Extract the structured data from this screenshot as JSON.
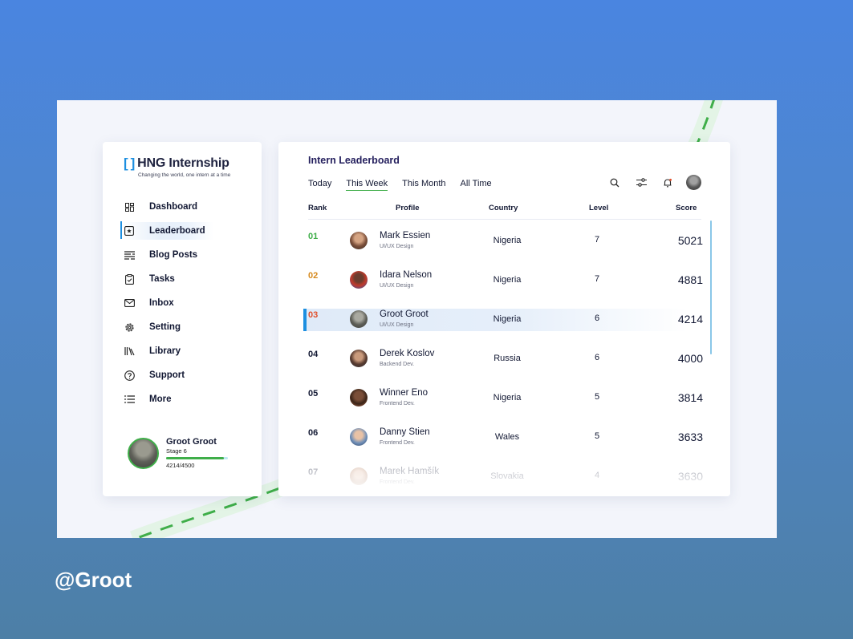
{
  "brand": {
    "title": "HNG Internship",
    "subtitle": "Changing the world, one intern at a time"
  },
  "colors": {
    "accent": "#1d8fe0",
    "success": "#3fae49",
    "rank1": "#3fae49",
    "rank2": "#d68a1e",
    "rank3": "#e1502c",
    "title": "#25205e"
  },
  "sidebar": {
    "items": [
      {
        "label": "Dashboard",
        "icon": "dashboard-icon"
      },
      {
        "label": "Leaderboard",
        "icon": "leaderboard-icon",
        "active": true
      },
      {
        "label": "Blog Posts",
        "icon": "blog-posts-icon"
      },
      {
        "label": "Tasks",
        "icon": "clipboard-icon"
      },
      {
        "label": "Inbox",
        "icon": "mail-icon"
      },
      {
        "label": "Setting",
        "icon": "gear-icon"
      },
      {
        "label": "Library",
        "icon": "library-icon"
      },
      {
        "label": "Support",
        "icon": "help-icon"
      },
      {
        "label": "More",
        "icon": "menu-icon"
      }
    ]
  },
  "user": {
    "name": "Groot Groot",
    "stage": "Stage 6",
    "xp": "4214/4500",
    "progress": 0.936
  },
  "main": {
    "title": "Intern Leaderboard",
    "tabs": [
      {
        "label": "Today"
      },
      {
        "label": "This Week",
        "active": true
      },
      {
        "label": "This Month"
      },
      {
        "label": "All Time"
      }
    ],
    "toolbar": [
      "search-icon",
      "filter-icon",
      "bell-icon",
      "avatar"
    ],
    "columns": [
      "Rank",
      "Profile",
      "Country",
      "Level",
      "Score"
    ],
    "rows": [
      {
        "rank": "01",
        "name": "Mark Essien",
        "role": "UI/UX Design",
        "country": "Nigeria",
        "level": "7",
        "score": "5021"
      },
      {
        "rank": "02",
        "name": "Idara Nelson",
        "role": "UI/UX Design",
        "country": "Nigeria",
        "level": "7",
        "score": "4881"
      },
      {
        "rank": "03",
        "name": "Groot Groot",
        "role": "UI/UX Design",
        "country": "Nigeria",
        "level": "6",
        "score": "4214",
        "highlight": true
      },
      {
        "rank": "04",
        "name": "Derek Koslov",
        "role": "Backend Dev.",
        "country": "Russia",
        "level": "6",
        "score": "4000"
      },
      {
        "rank": "05",
        "name": "Winner Eno",
        "role": "Frontend Dev.",
        "country": "Nigeria",
        "level": "5",
        "score": "3814"
      },
      {
        "rank": "06",
        "name": "Danny Stien",
        "role": "Frontend Dev.",
        "country": "Wales",
        "level": "5",
        "score": "3633"
      },
      {
        "rank": "07",
        "name": "Marek Hamšík",
        "role": "Frontend Dev.",
        "country": "Slovakia",
        "level": "4",
        "score": "3630"
      }
    ]
  },
  "footer": {
    "handle": "@Groot"
  }
}
